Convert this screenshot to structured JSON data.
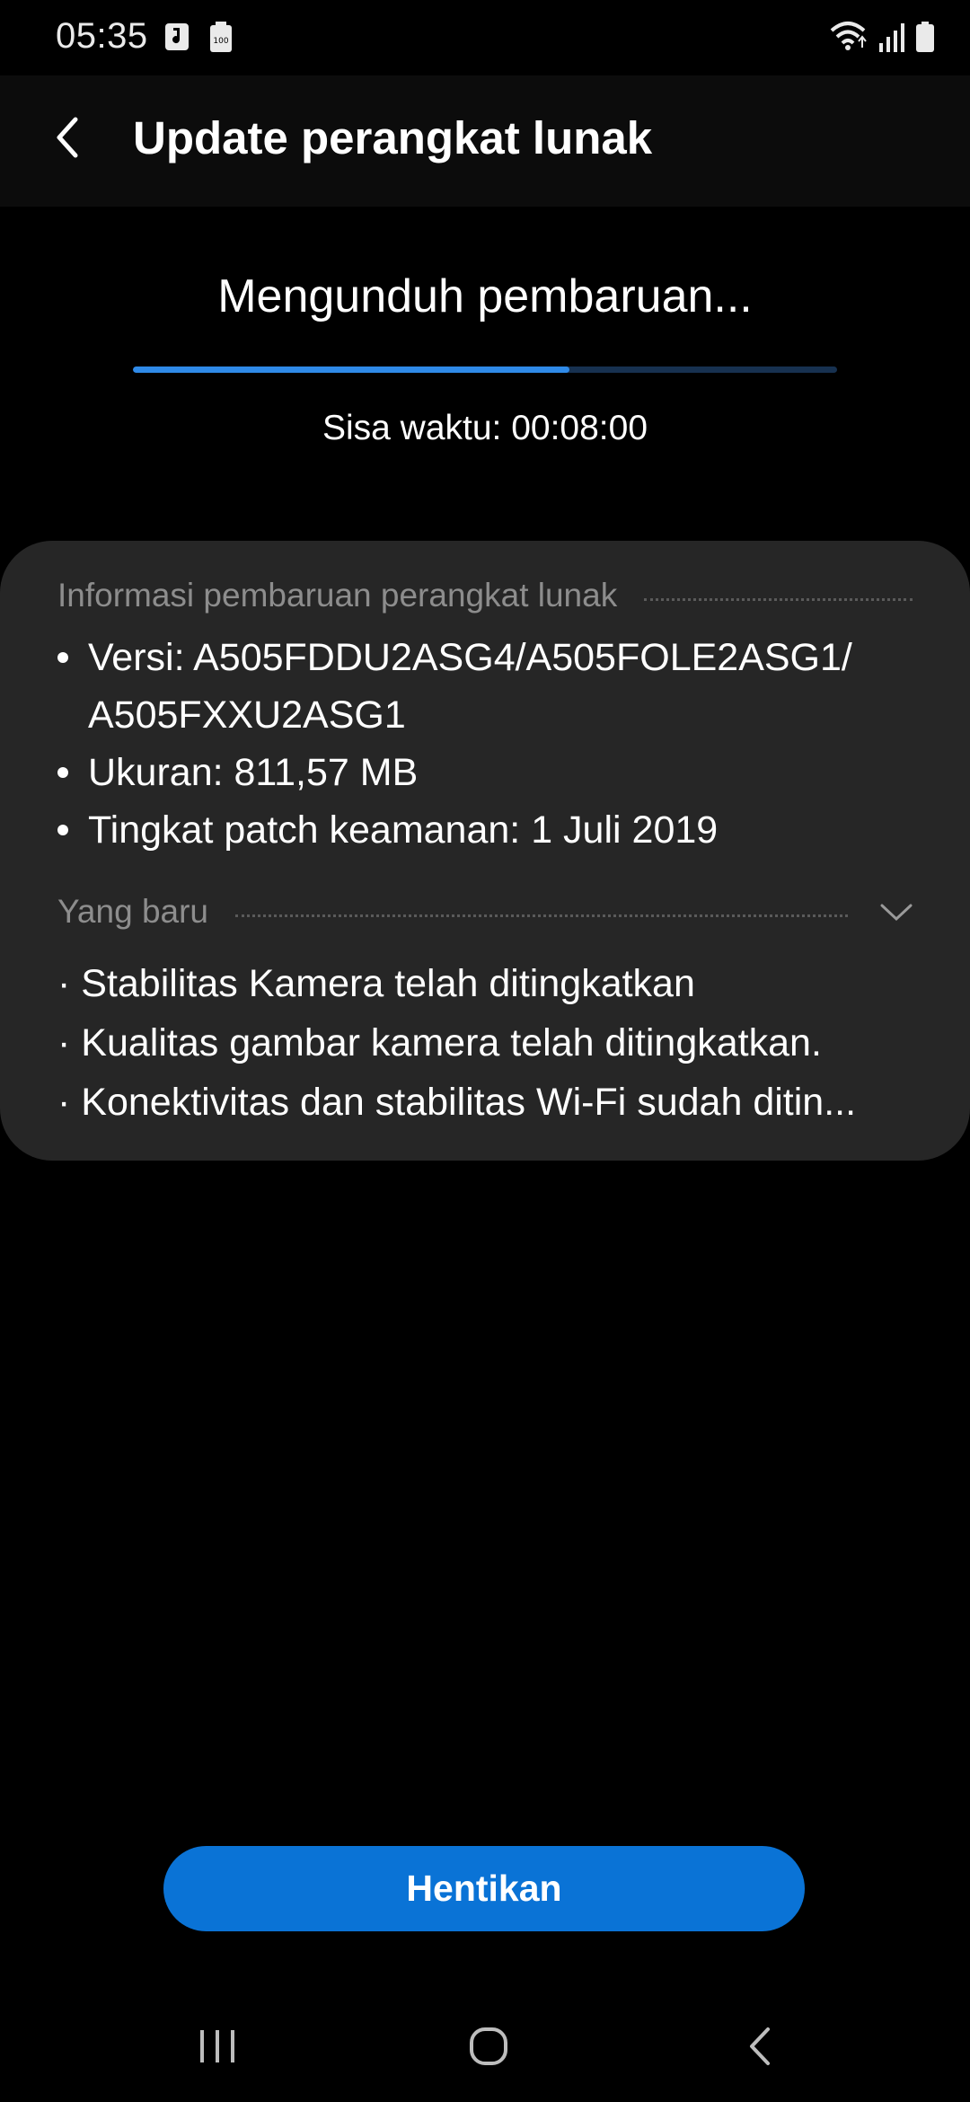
{
  "status_bar": {
    "time": "05:35",
    "left_icons": [
      "music-note-icon",
      "battery-saver-icon"
    ],
    "right_icons": [
      "wifi-icon",
      "signal-icon",
      "battery-icon"
    ]
  },
  "app_bar": {
    "title": "Update perangkat lunak"
  },
  "download": {
    "title": "Mengunduh pembaruan...",
    "progress": 0.62,
    "time_remaining": "Sisa waktu: 00:08:00"
  },
  "info": {
    "header": "Informasi pembaruan perangkat lunak",
    "items": [
      "Versi: A505FDDU2ASG4/A505FOLE2ASG1/ A505FXXU2ASG1",
      "Ukuran: 811,57 MB",
      "Tingkat patch keamanan: 1 Juli 2019"
    ]
  },
  "whats_new": {
    "header": "Yang baru",
    "items": [
      "· Stabilitas Kamera telah ditingkatkan",
      "· Kualitas gambar kamera telah ditingkatkan.",
      "· Konektivitas dan stabilitas Wi-Fi sudah ditin..."
    ]
  },
  "actions": {
    "stop_label": "Hentikan"
  },
  "colors": {
    "accent": "#0a73d6",
    "progress": "#2f8ae8",
    "card": "#262626"
  }
}
